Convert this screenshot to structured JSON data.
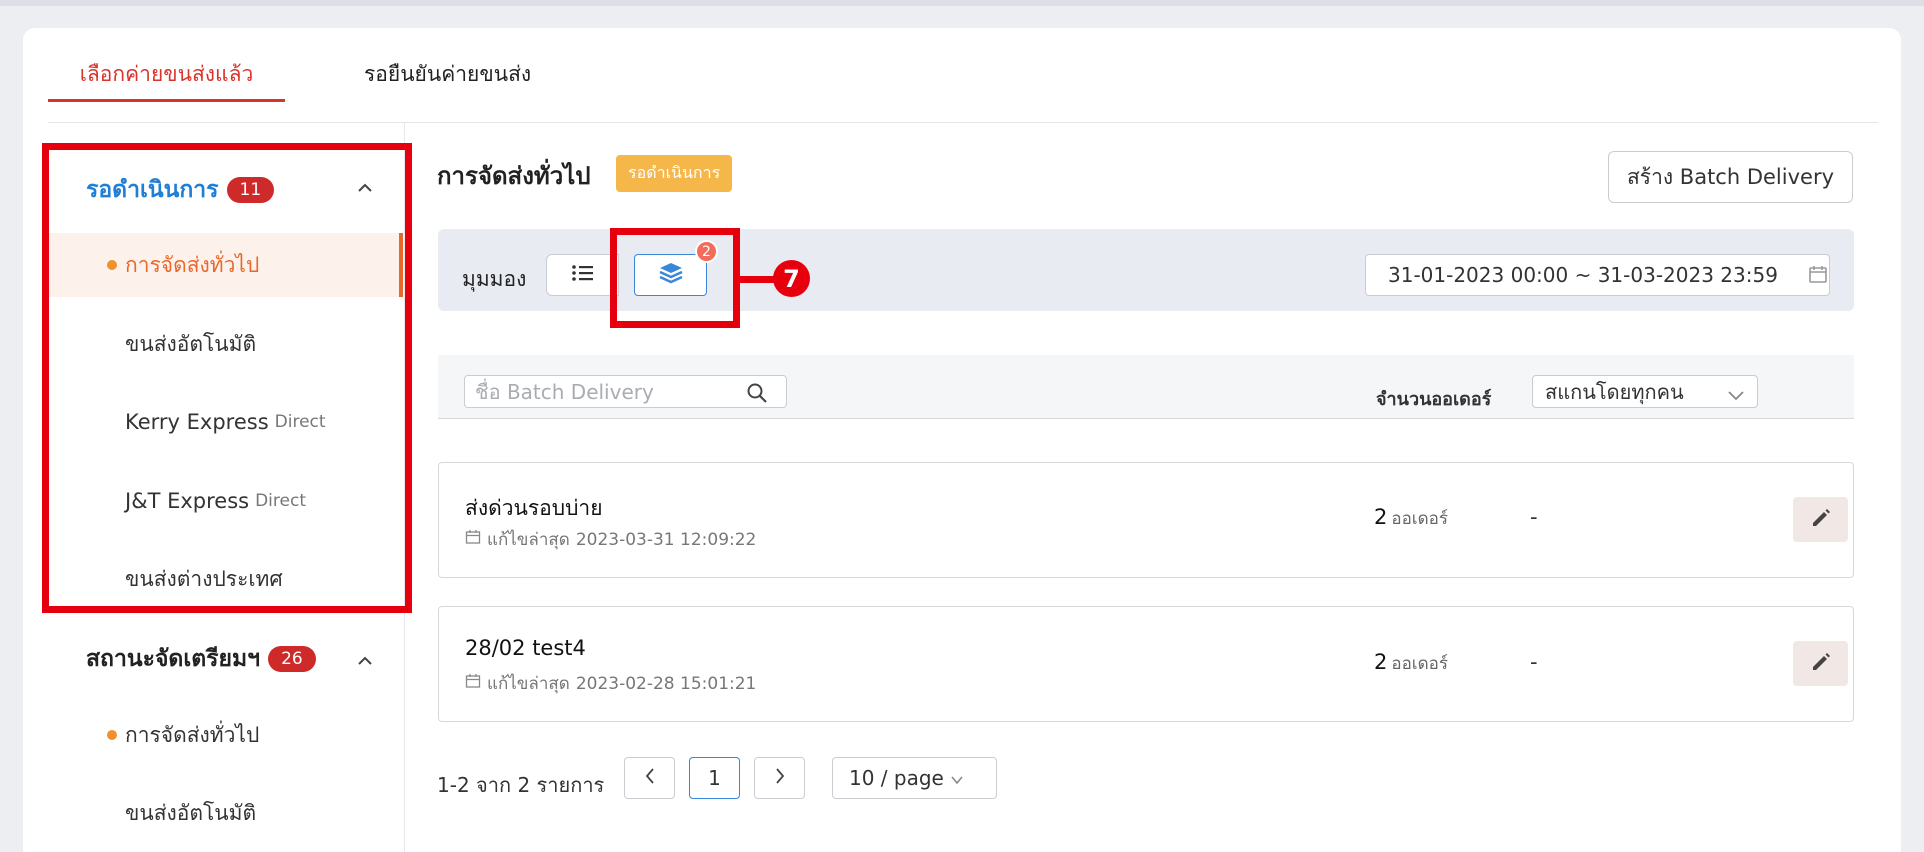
{
  "tabs": [
    {
      "label": "เลือกค่ายขนส่งแล้ว",
      "active": true
    },
    {
      "label": "รอยืนยันค่ายขนส่ง",
      "active": false
    }
  ],
  "sidebar": {
    "groups": [
      {
        "label": "รอดำเนินการ",
        "count": "11",
        "items": [
          {
            "label": "การจัดส่งทั่วไป",
            "sub": "",
            "active": true
          },
          {
            "label": "ขนส่งอัตโนมัติ",
            "sub": ""
          },
          {
            "label": "Kerry Express",
            "sub": "Direct"
          },
          {
            "label": "J&T Express",
            "sub": "Direct"
          },
          {
            "label": "ขนส่งต่างประเทศ",
            "sub": ""
          }
        ]
      },
      {
        "label": "สถานะจัดเตรียมฯ",
        "count": "26",
        "items": [
          {
            "label": "การจัดส่งทั่วไป",
            "sub": ""
          },
          {
            "label": "ขนส่งอัตโนมัติ",
            "sub": ""
          }
        ]
      }
    ]
  },
  "main": {
    "title": "การจัดส่งทั่วไป",
    "status": "รอดำเนินการ",
    "create_button": "สร้าง Batch Delivery"
  },
  "viewbar": {
    "label": "มุมมอง",
    "layer_badge": "2",
    "callout": "7",
    "date_range": "31-01-2023 00:00 ~ 31-03-2023 23:59"
  },
  "filters": {
    "search_placeholder": "ชื่อ Batch Delivery",
    "orders_column": "จำนวนออเดอร์",
    "scanner_select": "สแกนโดยทุกคน"
  },
  "rows": [
    {
      "name": "ส่งด่วนรอบบ่าย",
      "edited_label": "แก้ไขล่าสุด",
      "edited": "2023-03-31 12:09:22",
      "count": "2",
      "unit": "ออเดอร์",
      "scanner": "-"
    },
    {
      "name": "28/02 test4",
      "edited_label": "แก้ไขล่าสุด",
      "edited": "2023-02-28 15:01:21",
      "count": "2",
      "unit": "ออเดอร์",
      "scanner": "-"
    }
  ],
  "pagination": {
    "summary": "1-2 จาก 2 รายการ",
    "current_page": "1",
    "page_size": "10 / page"
  },
  "colors": {
    "accent_red": "#d9342b",
    "active_orange": "#e8692e",
    "status_yellow": "#f6b74a",
    "highlight_red": "#e6000e",
    "primary_blue": "#3a86d8"
  }
}
